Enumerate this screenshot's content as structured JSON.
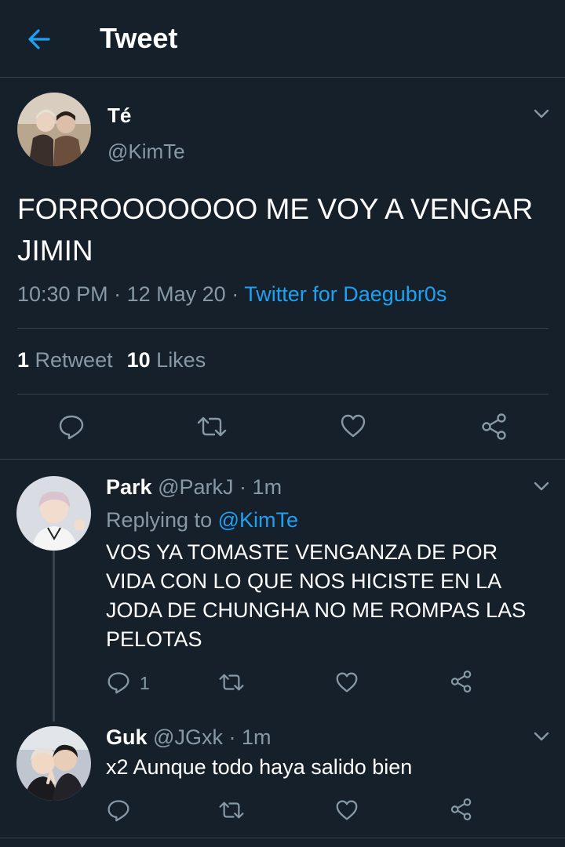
{
  "header": {
    "title": "Tweet"
  },
  "tweet": {
    "author_name": "Té",
    "author_handle": "@KimTe",
    "text": "FORROOOOOOO ME VOY A VENGAR JIMIN",
    "time": "10:30 PM",
    "date": "12 May 20",
    "source": "Twitter for Daegubr0s",
    "dot": "·",
    "retweets": {
      "count": "1",
      "label": "Retweet"
    },
    "likes": {
      "count": "10",
      "label": "Likes"
    }
  },
  "replies": [
    {
      "name": "Park",
      "handle": "@ParkJ",
      "dot": "·",
      "time": "1m",
      "replying_label": "Replying to",
      "replying_to": "@KimTe",
      "text": "VOS YA TOMASTE VENGANZA DE POR VIDA CON LO QUE NOS HICISTE EN LA JODA DE CHUNGHA NO ME ROMPAS LAS PELOTAS",
      "reply_count": "1"
    },
    {
      "name": "Guk",
      "handle": "@JGxk",
      "dot": "·",
      "time": "1m",
      "text": "x2 Aunque todo haya salido bien"
    }
  ],
  "colors": {
    "background": "#15202b",
    "accent": "#1da1f2",
    "muted": "#8899a6",
    "divider": "#38444d"
  },
  "icons": [
    "back-arrow-icon",
    "chevron-down-icon",
    "reply-icon",
    "retweet-icon",
    "like-icon",
    "share-icon"
  ]
}
